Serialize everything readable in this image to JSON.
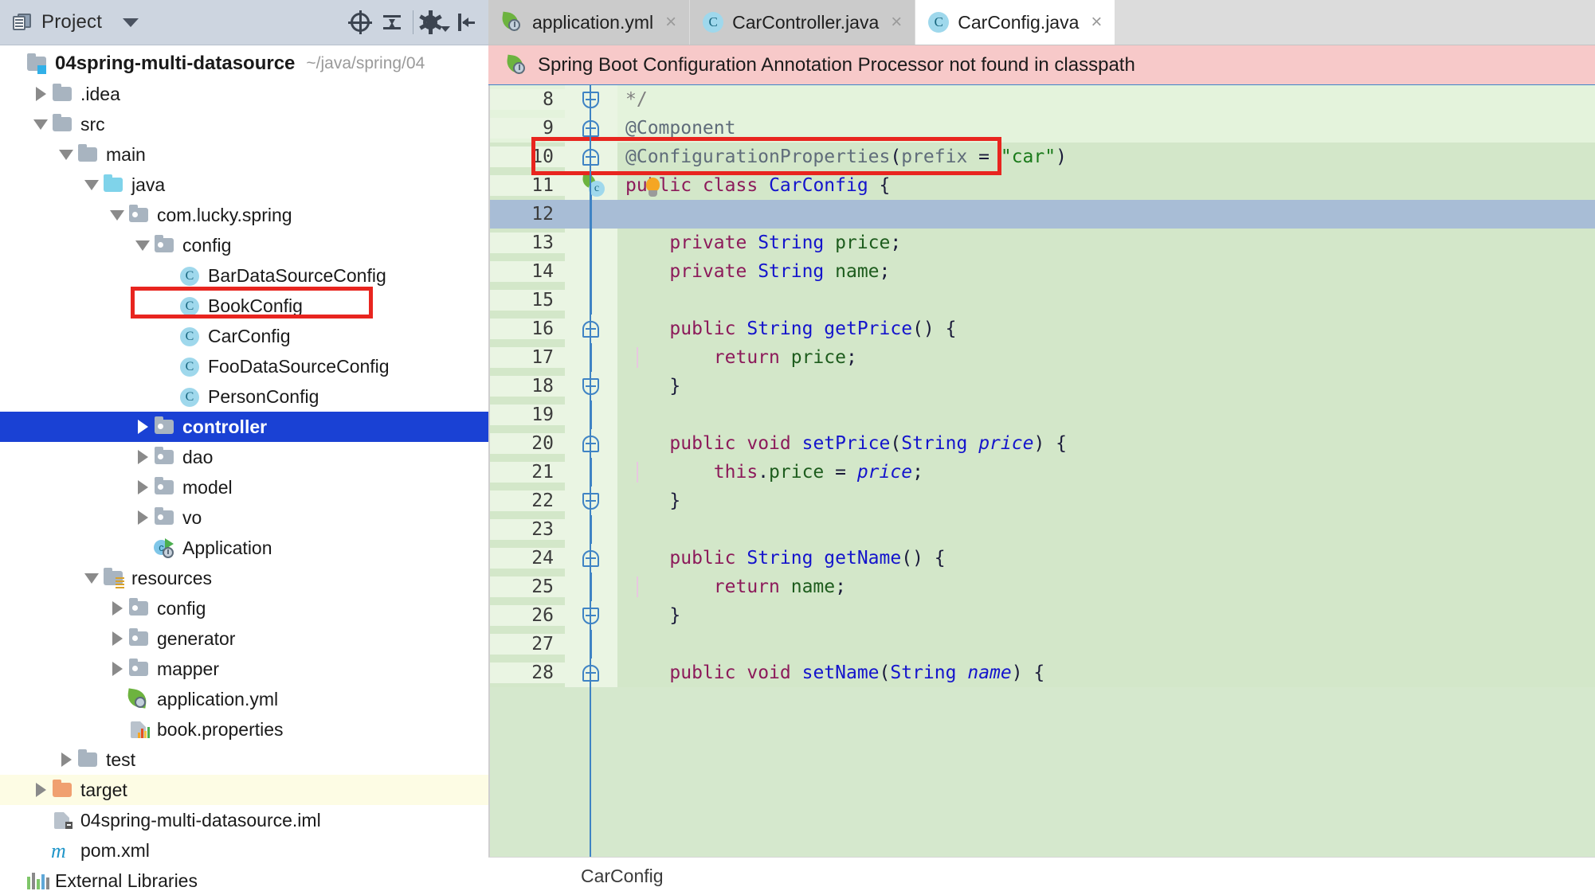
{
  "toolwindow": {
    "title": "Project",
    "icons": {
      "project_view": "project-view-icon",
      "dropdown": "chevron-down-icon",
      "locate": "locate-target-icon",
      "collapse_all": "collapse-all-icon",
      "settings": "gear-icon",
      "hide": "hide-panel-icon"
    }
  },
  "tree": {
    "root": {
      "label": "04spring-multi-datasource",
      "path": "~/java/spring/04"
    },
    "items": [
      {
        "label": ".idea",
        "depth": 1,
        "icon": "folder",
        "arrow": "closed"
      },
      {
        "label": "src",
        "depth": 1,
        "icon": "folder",
        "arrow": "open"
      },
      {
        "label": "main",
        "depth": 2,
        "icon": "folder",
        "arrow": "open"
      },
      {
        "label": "java",
        "depth": 3,
        "icon": "folder-source",
        "arrow": "open"
      },
      {
        "label": "com.lucky.spring",
        "depth": 4,
        "icon": "folder-package",
        "arrow": "open"
      },
      {
        "label": "config",
        "depth": 5,
        "icon": "folder-package",
        "arrow": "open"
      },
      {
        "label": "BarDataSourceConfig",
        "depth": 6,
        "icon": "java-class",
        "arrow": "none"
      },
      {
        "label": "BookConfig",
        "depth": 6,
        "icon": "java-class",
        "arrow": "none"
      },
      {
        "label": "CarConfig",
        "depth": 6,
        "icon": "java-class",
        "arrow": "none",
        "highlighted": true
      },
      {
        "label": "FooDataSourceConfig",
        "depth": 6,
        "icon": "java-class",
        "arrow": "none"
      },
      {
        "label": "PersonConfig",
        "depth": 6,
        "icon": "java-class",
        "arrow": "none"
      },
      {
        "label": "controller",
        "depth": 5,
        "icon": "folder-package",
        "arrow": "closed",
        "selected": true
      },
      {
        "label": "dao",
        "depth": 5,
        "icon": "folder-package",
        "arrow": "closed"
      },
      {
        "label": "model",
        "depth": 5,
        "icon": "folder-package",
        "arrow": "closed"
      },
      {
        "label": "vo",
        "depth": 5,
        "icon": "folder-package",
        "arrow": "closed"
      },
      {
        "label": "Application",
        "depth": 5,
        "icon": "spring-boot-run",
        "arrow": "none"
      },
      {
        "label": "resources",
        "depth": 3,
        "icon": "folder-resources",
        "arrow": "open"
      },
      {
        "label": "config",
        "depth": 4,
        "icon": "folder-package",
        "arrow": "closed"
      },
      {
        "label": "generator",
        "depth": 4,
        "icon": "folder-package",
        "arrow": "closed"
      },
      {
        "label": "mapper",
        "depth": 4,
        "icon": "folder-package",
        "arrow": "closed"
      },
      {
        "label": "application.yml",
        "depth": 4,
        "icon": "spring-yaml",
        "arrow": "none"
      },
      {
        "label": "book.properties",
        "depth": 4,
        "icon": "properties-file",
        "arrow": "none"
      },
      {
        "label": "test",
        "depth": 2,
        "icon": "folder",
        "arrow": "closed"
      },
      {
        "label": "target",
        "depth": 1,
        "icon": "folder-excluded",
        "arrow": "closed",
        "excluded": true
      },
      {
        "label": "04spring-multi-datasource.iml",
        "depth": 1,
        "icon": "iml-file",
        "arrow": "none"
      },
      {
        "label": "pom.xml",
        "depth": 1,
        "icon": "maven-file",
        "arrow": "none"
      },
      {
        "label": "External Libraries",
        "depth": 0,
        "icon": "external-libraries",
        "arrow": "none"
      }
    ]
  },
  "tabs": [
    {
      "label": "application.yml",
      "icon": "spring-yaml",
      "active": false,
      "close": "×"
    },
    {
      "label": "CarController.java",
      "icon": "java-class",
      "active": false,
      "close": "×"
    },
    {
      "label": "CarConfig.java",
      "icon": "java-class",
      "active": true,
      "close": "×"
    }
  ],
  "notification": {
    "icon": "spring-boot-icon",
    "text": "Spring Boot Configuration Annotation Processor not found in classpath"
  },
  "editor": {
    "first_line": 8,
    "lines": [
      {
        "n": 8,
        "tokens": [
          {
            "t": "*/",
            "c": "cm"
          }
        ],
        "fold": "end",
        "state": "added"
      },
      {
        "n": 9,
        "tokens": [
          {
            "t": "@Component",
            "c": "an"
          }
        ],
        "fold": "start",
        "state": "added"
      },
      {
        "n": 10,
        "tokens": [
          {
            "t": "@ConfigurationProperties",
            "c": "an"
          },
          {
            "t": "(",
            "c": "pl"
          },
          {
            "t": "prefix",
            "c": "an"
          },
          {
            "t": " = ",
            "c": "pl"
          },
          {
            "t": "\"car\"",
            "c": "st"
          },
          {
            "t": ")",
            "c": "pl"
          }
        ],
        "fold": "mid",
        "state": "added-strong",
        "highlighted": true
      },
      {
        "n": 11,
        "tokens": [
          {
            "t": "public",
            "c": "k"
          },
          {
            "t": " ",
            "c": "pl"
          },
          {
            "t": "class",
            "c": "k"
          },
          {
            "t": " ",
            "c": "pl"
          },
          {
            "t": "CarConfig",
            "c": "ty"
          },
          {
            "t": " {",
            "c": "pl"
          }
        ],
        "gutter": "spring-bean",
        "bulb": true,
        "state": "added-strong"
      },
      {
        "n": 12,
        "tokens": [],
        "state": "caret"
      },
      {
        "n": 13,
        "tokens": [
          {
            "t": "    ",
            "c": "pl"
          },
          {
            "t": "private",
            "c": "k"
          },
          {
            "t": " ",
            "c": "pl"
          },
          {
            "t": "String",
            "c": "ty"
          },
          {
            "t": " ",
            "c": "pl"
          },
          {
            "t": "price",
            "c": "fd"
          },
          {
            "t": ";",
            "c": "pl"
          }
        ],
        "state": "added-strong"
      },
      {
        "n": 14,
        "tokens": [
          {
            "t": "    ",
            "c": "pl"
          },
          {
            "t": "private",
            "c": "k"
          },
          {
            "t": " ",
            "c": "pl"
          },
          {
            "t": "String",
            "c": "ty"
          },
          {
            "t": " ",
            "c": "pl"
          },
          {
            "t": "name",
            "c": "fd"
          },
          {
            "t": ";",
            "c": "pl"
          }
        ],
        "state": "added-strong"
      },
      {
        "n": 15,
        "tokens": [],
        "state": "added-strong"
      },
      {
        "n": 16,
        "tokens": [
          {
            "t": "    ",
            "c": "pl"
          },
          {
            "t": "public",
            "c": "k"
          },
          {
            "t": " ",
            "c": "pl"
          },
          {
            "t": "String",
            "c": "ty"
          },
          {
            "t": " ",
            "c": "pl"
          },
          {
            "t": "getPrice",
            "c": "mth"
          },
          {
            "t": "() {",
            "c": "pl"
          }
        ],
        "fold": "start",
        "state": "added-strong"
      },
      {
        "n": 17,
        "tokens": [
          {
            "t": "        ",
            "c": "pl"
          },
          {
            "t": "return",
            "c": "k"
          },
          {
            "t": " ",
            "c": "pl"
          },
          {
            "t": "price",
            "c": "fd"
          },
          {
            "t": ";",
            "c": "pl"
          }
        ],
        "state": "added-strong",
        "guide": true
      },
      {
        "n": 18,
        "tokens": [
          {
            "t": "    }",
            "c": "pl"
          }
        ],
        "fold": "end",
        "state": "added-strong"
      },
      {
        "n": 19,
        "tokens": [],
        "state": "added-strong"
      },
      {
        "n": 20,
        "tokens": [
          {
            "t": "    ",
            "c": "pl"
          },
          {
            "t": "public",
            "c": "k"
          },
          {
            "t": " ",
            "c": "pl"
          },
          {
            "t": "void",
            "c": "k"
          },
          {
            "t": " ",
            "c": "pl"
          },
          {
            "t": "setPrice",
            "c": "mth"
          },
          {
            "t": "(",
            "c": "pl"
          },
          {
            "t": "String",
            "c": "ty"
          },
          {
            "t": " ",
            "c": "pl"
          },
          {
            "t": "price",
            "c": "pm"
          },
          {
            "t": ") {",
            "c": "pl"
          }
        ],
        "fold": "start",
        "state": "added-strong"
      },
      {
        "n": 21,
        "tokens": [
          {
            "t": "        ",
            "c": "pl"
          },
          {
            "t": "this",
            "c": "k"
          },
          {
            "t": ".",
            "c": "pl"
          },
          {
            "t": "price",
            "c": "fd"
          },
          {
            "t": " = ",
            "c": "pl"
          },
          {
            "t": "price",
            "c": "pm"
          },
          {
            "t": ";",
            "c": "pl"
          }
        ],
        "state": "added-strong",
        "guide": true
      },
      {
        "n": 22,
        "tokens": [
          {
            "t": "    }",
            "c": "pl"
          }
        ],
        "fold": "end",
        "state": "added-strong"
      },
      {
        "n": 23,
        "tokens": [],
        "state": "added-strong"
      },
      {
        "n": 24,
        "tokens": [
          {
            "t": "    ",
            "c": "pl"
          },
          {
            "t": "public",
            "c": "k"
          },
          {
            "t": " ",
            "c": "pl"
          },
          {
            "t": "String",
            "c": "ty"
          },
          {
            "t": " ",
            "c": "pl"
          },
          {
            "t": "getName",
            "c": "mth"
          },
          {
            "t": "() {",
            "c": "pl"
          }
        ],
        "fold": "start",
        "state": "added-strong"
      },
      {
        "n": 25,
        "tokens": [
          {
            "t": "        ",
            "c": "pl"
          },
          {
            "t": "return",
            "c": "k"
          },
          {
            "t": " ",
            "c": "pl"
          },
          {
            "t": "name",
            "c": "fd"
          },
          {
            "t": ";",
            "c": "pl"
          }
        ],
        "state": "added-strong",
        "guide": true
      },
      {
        "n": 26,
        "tokens": [
          {
            "t": "    }",
            "c": "pl"
          }
        ],
        "fold": "end",
        "state": "added-strong"
      },
      {
        "n": 27,
        "tokens": [],
        "state": "added-strong"
      },
      {
        "n": 28,
        "tokens": [
          {
            "t": "    ",
            "c": "pl"
          },
          {
            "t": "public",
            "c": "k"
          },
          {
            "t": " ",
            "c": "pl"
          },
          {
            "t": "void",
            "c": "k"
          },
          {
            "t": " ",
            "c": "pl"
          },
          {
            "t": "setName",
            "c": "mth"
          },
          {
            "t": "(",
            "c": "pl"
          },
          {
            "t": "String",
            "c": "ty"
          },
          {
            "t": " ",
            "c": "pl"
          },
          {
            "t": "name",
            "c": "pm"
          },
          {
            "t": ") {",
            "c": "pl"
          }
        ],
        "fold": "start",
        "state": "added-strong"
      }
    ]
  },
  "statusbar": {
    "breadcrumb": "CarConfig"
  },
  "colors": {
    "selection_blue": "#1a41d4",
    "highlight_red": "#e8251f",
    "notification_bg": "#f7c9c9",
    "vcs_added_green": "#d3e7c9",
    "caret_line": "#a8bdd6",
    "spring_green": "#6db33f"
  }
}
